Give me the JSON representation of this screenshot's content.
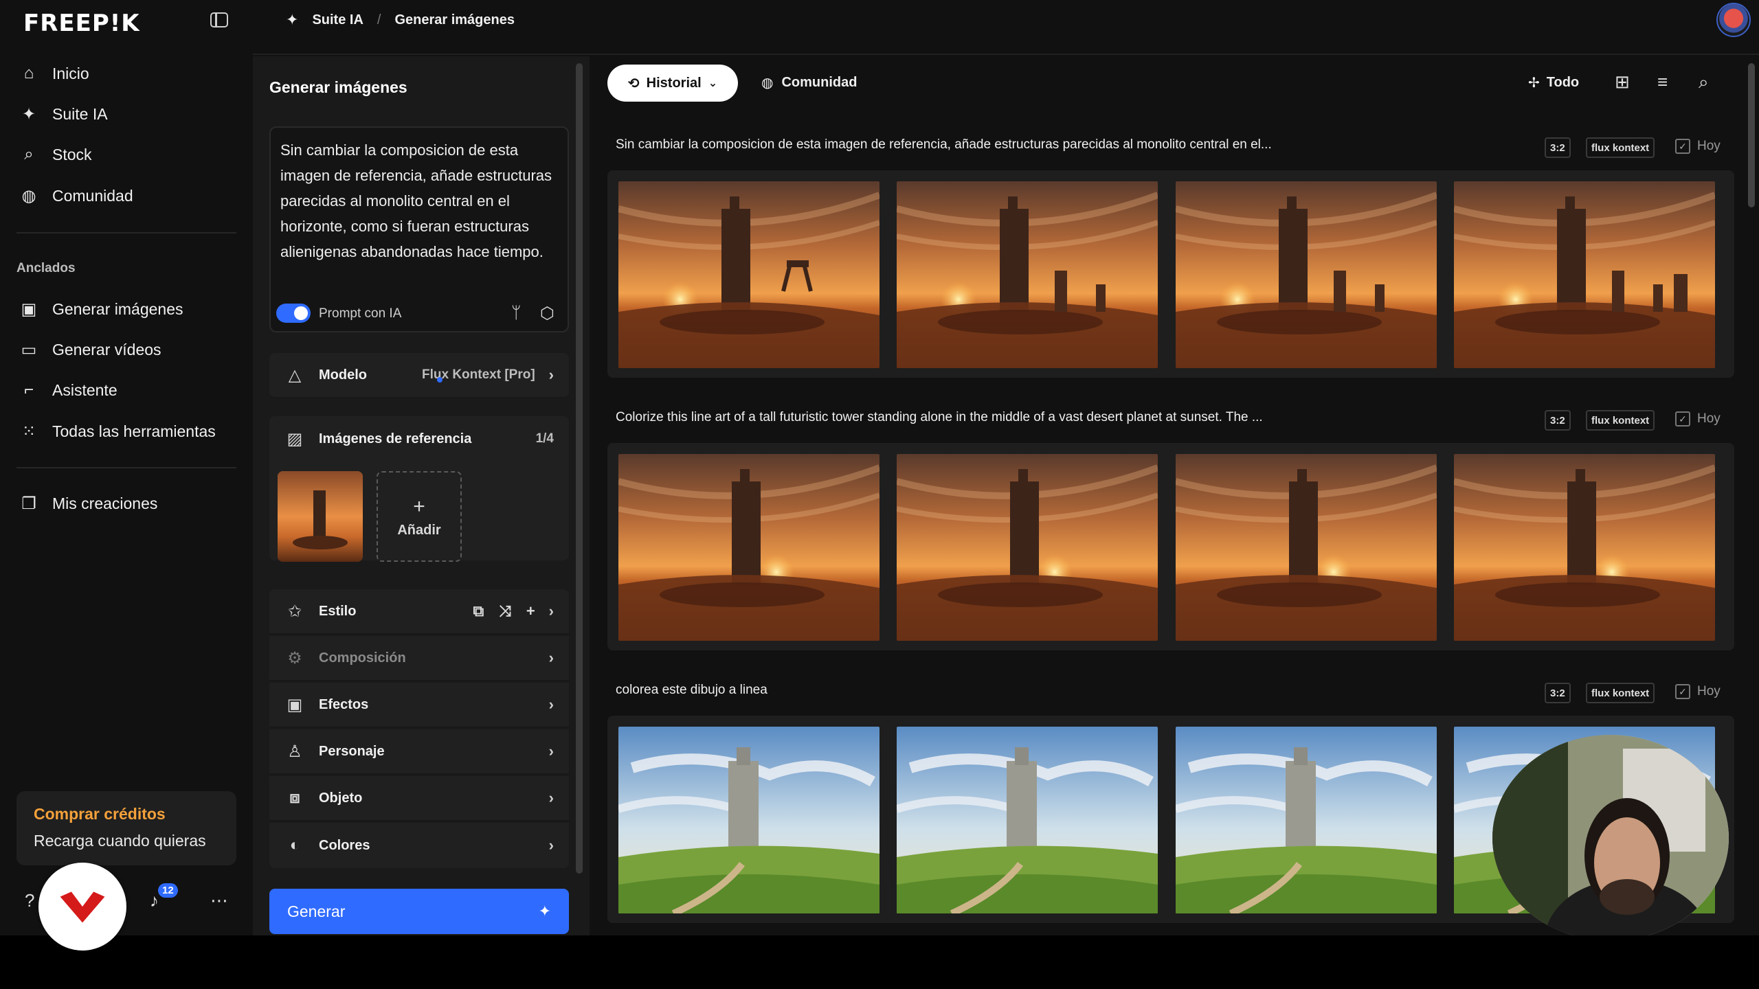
{
  "brand": {
    "logo_text": "FREEP!K"
  },
  "nav": {
    "main": [
      {
        "label": "Inicio",
        "icon": "home-icon"
      },
      {
        "label": "Suite IA",
        "icon": "sparkle-icon"
      },
      {
        "label": "Stock",
        "icon": "search-icon"
      },
      {
        "label": "Comunidad",
        "icon": "globe-icon"
      }
    ],
    "pinned_label": "Anclados",
    "pinned": [
      {
        "label": "Generar imágenes",
        "icon": "image-generate-icon"
      },
      {
        "label": "Generar vídeos",
        "icon": "video-icon"
      },
      {
        "label": "Asistente",
        "icon": "chat-icon"
      },
      {
        "label": "Todas las herramientas",
        "icon": "grid-icon"
      }
    ],
    "creations": {
      "label": "Mis creaciones",
      "icon": "folder-icon"
    },
    "credits": {
      "title": "Comprar créditos",
      "subtitle": "Recarga cuando quieras"
    },
    "notifications_count": "12"
  },
  "breadcrumb": {
    "items": [
      "Suite IA",
      "Generar imágenes"
    ]
  },
  "panel": {
    "title": "Generar imágenes",
    "prompt": "Sin cambiar la composicion de esta imagen de referencia, añade estructuras parecidas al monolito central en el horizonte, como si fueran estructuras alienigenas abandonadas hace tiempo.",
    "prompt_ai_label": "Prompt con IA",
    "model": {
      "label": "Modelo",
      "value": "Flux Kontext [Pro]"
    },
    "reference": {
      "label": "Imágenes de referencia",
      "count": "1/4",
      "add_label": "Añadir"
    },
    "options": [
      {
        "label": "Estilo",
        "icon": "style-star-icon",
        "enabled": true
      },
      {
        "label": "Composición",
        "icon": "composition-icon",
        "enabled": false
      },
      {
        "label": "Efectos",
        "icon": "effects-icon",
        "enabled": true
      },
      {
        "label": "Personaje",
        "icon": "person-icon",
        "enabled": true
      },
      {
        "label": "Objeto",
        "icon": "object-icon",
        "enabled": true
      },
      {
        "label": "Colores",
        "icon": "palette-icon",
        "enabled": true
      }
    ],
    "generate_label": "Generar"
  },
  "main": {
    "tabs": {
      "history": "Historial",
      "community": "Comunidad"
    },
    "filter": "Todo",
    "groups": [
      {
        "prompt": "Sin cambiar la composicion de esta imagen de referencia, añade estructuras parecidas al monolito central en el...",
        "ratio": "3:2",
        "model": "flux kontext",
        "date": "Hoy",
        "style": "desert-monoliths"
      },
      {
        "prompt": "Colorize this line art of a tall futuristic tower standing alone in the middle of a vast desert planet at sunset. The ...",
        "ratio": "3:2",
        "model": "flux kontext",
        "date": "Hoy",
        "style": "desert-tower"
      },
      {
        "prompt": "colorea este dibujo a linea",
        "ratio": "3:2",
        "model": "flux kontext",
        "date": "Hoy",
        "style": "green-tower"
      }
    ]
  },
  "colors": {
    "accent": "#2f6bff",
    "credits": "#f4a13b"
  }
}
